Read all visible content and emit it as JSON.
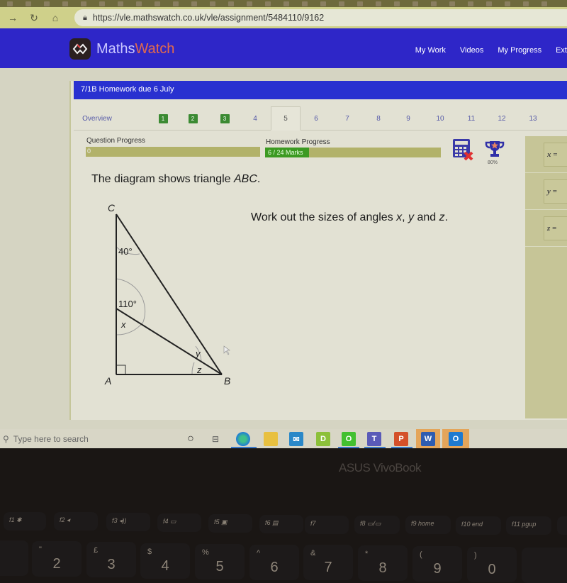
{
  "browser": {
    "nav": {
      "back_icon": "arrow-right",
      "reload_icon": "reload",
      "home_icon": "home"
    },
    "url": "https://vle.mathswatch.co.uk/vle/assignment/5484110/9162"
  },
  "app": {
    "brand_prefix": "Maths",
    "brand_suffix": "Watch",
    "nav_items": [
      "My Work",
      "Videos",
      "My Progress",
      "Ext"
    ]
  },
  "homework": {
    "title": "7/1B Homework due 6 July",
    "tabs": [
      {
        "label": "Overview",
        "state": "link"
      },
      {
        "label": "1",
        "state": "complete"
      },
      {
        "label": "2",
        "state": "complete"
      },
      {
        "label": "3",
        "state": "complete"
      },
      {
        "label": "4",
        "state": "pending"
      },
      {
        "label": "5",
        "state": "active"
      },
      {
        "label": "6",
        "state": "pending"
      },
      {
        "label": "7",
        "state": "pending"
      },
      {
        "label": "8",
        "state": "pending"
      },
      {
        "label": "9",
        "state": "pending"
      },
      {
        "label": "10",
        "state": "pending"
      },
      {
        "label": "11",
        "state": "pending"
      },
      {
        "label": "12",
        "state": "pending"
      },
      {
        "label": "13",
        "state": "pending"
      }
    ],
    "question_progress": {
      "label": "Question Progress",
      "value_text": "0",
      "fraction": 0
    },
    "homework_progress": {
      "label": "Homework Progress",
      "value_text": "6 / 24 Marks",
      "marks": 6,
      "total": 24,
      "fraction": 0.25
    },
    "calculator_status": "calculator-not-allowed",
    "trophy_target": "80%"
  },
  "question": {
    "intro_prefix": "The diagram shows triangle ",
    "intro_italic": "ABC",
    "intro_suffix": ".",
    "task_prefix": "Work out the sizes of angles ",
    "task_x": "x",
    "task_sep1": ", ",
    "task_y": "y",
    "task_sep2": " and ",
    "task_z": "z",
    "task_suffix": ".",
    "diagram": {
      "vertices": {
        "A": "A",
        "B": "B",
        "C": "C"
      },
      "angle_C": "40°",
      "angle_at_point_on_AC": "110°",
      "label_x": "x",
      "label_y": "y",
      "label_z": "z",
      "right_angle_at": "A"
    },
    "answers": [
      {
        "label": "x =",
        "value": ""
      },
      {
        "label": "y =",
        "value": ""
      },
      {
        "label": "z =",
        "value": ""
      }
    ]
  },
  "taskbar": {
    "search_placeholder": "Type here to search",
    "apps": [
      "cortana",
      "task-view",
      "edge",
      "file-explorer",
      "mail",
      "docs-d",
      "green-app",
      "teams",
      "powerpoint",
      "word",
      "blue-app"
    ],
    "label_docs": "D",
    "label_green": "O",
    "label_ppt": "P",
    "label_word": "W",
    "label_blue": "O"
  },
  "device": {
    "bezel_label": "ASUS VivoBook",
    "function_keys": [
      "f1",
      "f2",
      "f3",
      "f4",
      "f5",
      "f6",
      "f7",
      "f8",
      "f9 home",
      "f10 end",
      "f11 pgup"
    ],
    "number_keys": [
      {
        "main": "2",
        "shift": "\""
      },
      {
        "main": "3",
        "shift": "£"
      },
      {
        "main": "4",
        "shift": "$"
      },
      {
        "main": "5",
        "shift": "%"
      },
      {
        "main": "6",
        "shift": "^"
      },
      {
        "main": "7",
        "shift": "&"
      },
      {
        "main": "8",
        "shift": "*"
      },
      {
        "main": "9",
        "shift": "("
      },
      {
        "main": "0",
        "shift": ")"
      }
    ]
  }
}
